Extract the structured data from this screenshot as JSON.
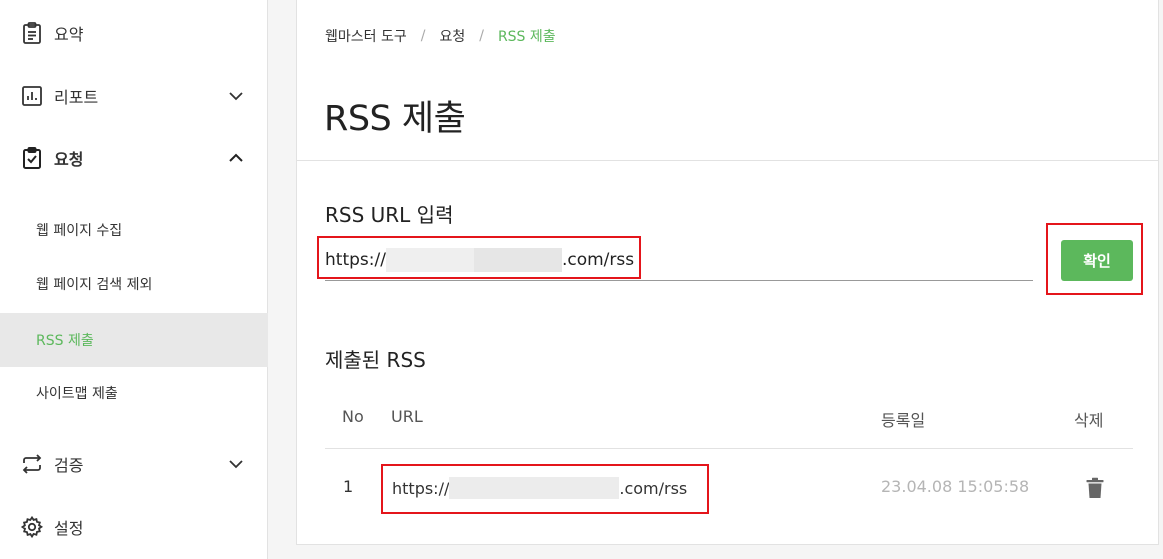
{
  "sidebar": {
    "summary": "요약",
    "report": "리포트",
    "request": "요청",
    "request_items": [
      "웹 페이지 수집",
      "웹 페이지 검색 제외",
      "RSS 제출",
      "사이트맵 제출"
    ],
    "verify": "검증",
    "settings": "설정"
  },
  "breadcrumb": [
    "웹마스터 도구",
    "요청",
    "RSS 제출"
  ],
  "page_title": "RSS 제출",
  "input_section": {
    "label": "RSS URL 입력",
    "value_prefix": "https://",
    "value_suffix": ".com/rss",
    "confirm_label": "확인"
  },
  "submitted": {
    "label": "제출된 RSS",
    "headers": {
      "no": "No",
      "url": "URL",
      "date": "등록일",
      "delete": "삭제"
    },
    "rows": [
      {
        "no": "1",
        "url_prefix": "https://",
        "url_suffix": ".com/rss",
        "date": "23.04.08 15:05:58"
      }
    ]
  },
  "colors": {
    "accent": "#5cb85c",
    "highlight": "#e4151b"
  }
}
